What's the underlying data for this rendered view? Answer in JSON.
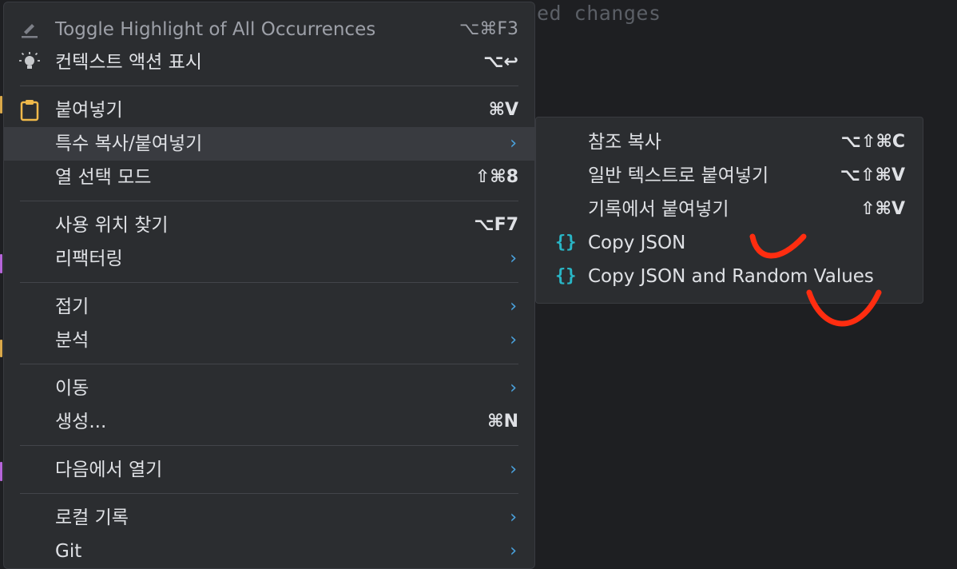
{
  "editor": {
    "background_text": "ed changes"
  },
  "colors": {
    "accent_arrow": "#4aa3df",
    "json_icon": "#29b6c6",
    "annotation": "#ff2d10",
    "clipboard_icon": "#f0b94a"
  },
  "context_menu": {
    "items": [
      {
        "icon": "highlight-icon",
        "label": "Toggle Highlight of All Occurrences",
        "shortcut": "⌥⌘F3"
      },
      {
        "icon": "lightbulb-icon",
        "label": "컨텍스트 액션 표시",
        "shortcut": "⌥↩"
      },
      {
        "icon": "clipboard-icon",
        "label": "붙여넣기",
        "shortcut": "⌘V"
      },
      {
        "label": "특수 복사/붙여넣기",
        "submenu_arrow": "›"
      },
      {
        "label": "열 선택 모드",
        "shortcut": "⇧⌘8"
      },
      {
        "label": "사용 위치 찾기",
        "shortcut": "⌥F7"
      },
      {
        "label": "리팩터링",
        "submenu_arrow": "›"
      },
      {
        "label": "접기",
        "submenu_arrow": "›"
      },
      {
        "label": "분석",
        "submenu_arrow": "›"
      },
      {
        "label": "이동",
        "submenu_arrow": "›"
      },
      {
        "label": "생성...",
        "shortcut": "⌘N"
      },
      {
        "label": "다음에서 열기",
        "submenu_arrow": "›"
      },
      {
        "label": "로컬 기록",
        "submenu_arrow": "›"
      },
      {
        "label": "Git",
        "submenu_arrow": "›"
      }
    ]
  },
  "submenu": {
    "items": [
      {
        "label": "참조 복사",
        "shortcut": "⌥⇧⌘C"
      },
      {
        "label": "일반 텍스트로 붙여넣기",
        "shortcut": "⌥⇧⌘V"
      },
      {
        "label": "기록에서 붙여넣기",
        "shortcut": "⇧⌘V"
      },
      {
        "icon": "{}",
        "label": "Copy JSON"
      },
      {
        "icon": "{}",
        "label": "Copy JSON and Random Values"
      }
    ]
  }
}
